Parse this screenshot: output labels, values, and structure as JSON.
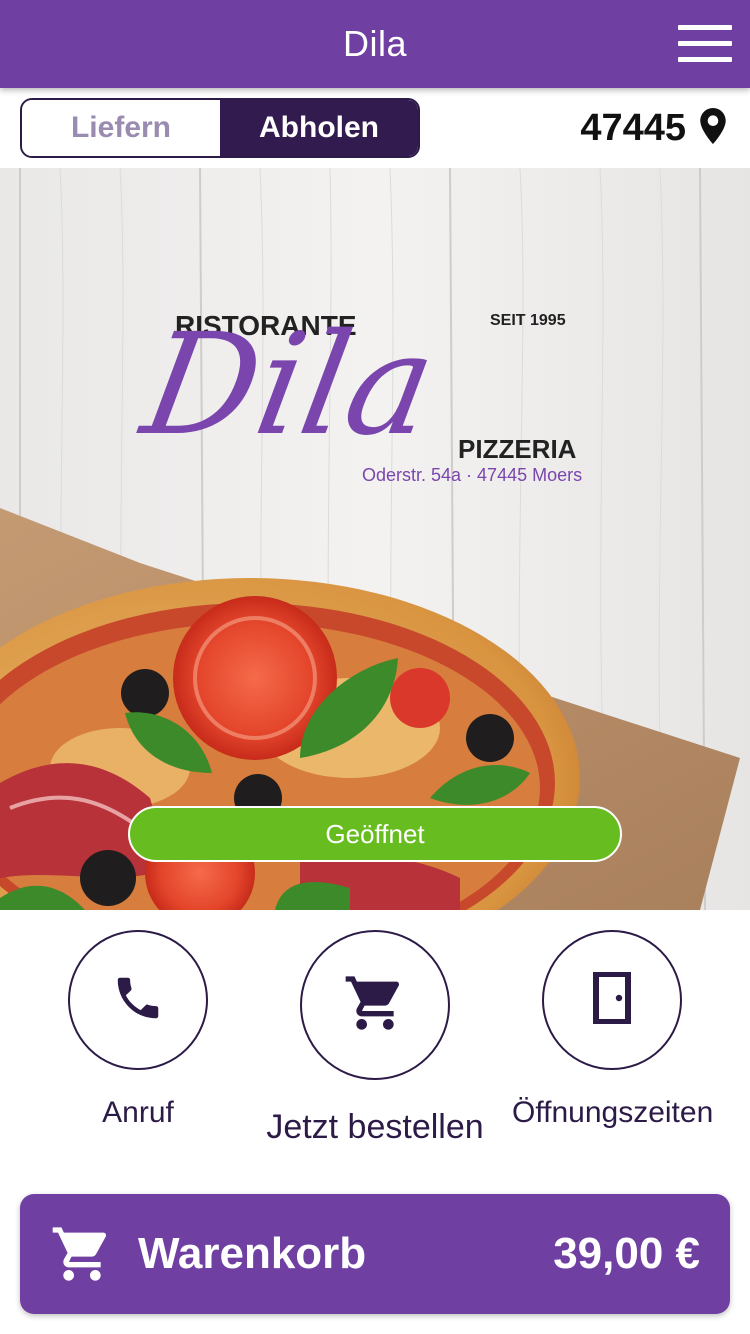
{
  "header": {
    "title": "Dila",
    "menu_icon": "hamburger-menu-icon"
  },
  "mode_toggle": {
    "options": [
      "Liefern",
      "Abholen"
    ],
    "selected": "Abholen"
  },
  "location": {
    "postal_code": "47445",
    "icon": "location-pin-icon"
  },
  "hero": {
    "logo_top_left": "RISTORANTE",
    "logo_since": "SEIT 1995",
    "logo_script": "Dila",
    "logo_sub": "PIZZERIA",
    "address": "Oderstr. 54a · 47445 Moers",
    "status": "Geöffnet",
    "status_color": "#67bd1f"
  },
  "actions": [
    {
      "label": "Anruf",
      "icon": "phone-icon"
    },
    {
      "label": "Jetzt bestellen",
      "icon": "shopping-cart-icon"
    },
    {
      "label": "Öffnungszeiten",
      "icon": "door-icon"
    }
  ],
  "cart": {
    "label": "Warenkorb",
    "total": "39,00 €",
    "icon": "shopping-cart-icon"
  },
  "colors": {
    "brand": "#6f3fa2",
    "dark": "#2c1a47",
    "open_green": "#67bd1f"
  }
}
